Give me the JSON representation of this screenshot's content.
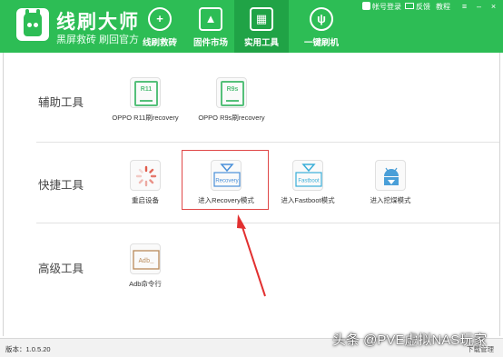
{
  "app": {
    "title": "线刷大师",
    "subtitle": "黑屏救砖 刷回官方"
  },
  "nav": [
    {
      "label": "线刷救砖",
      "icon": "plus-circle-icon"
    },
    {
      "label": "固件市场",
      "icon": "android-icon"
    },
    {
      "label": "实用工具",
      "icon": "grid-icon"
    },
    {
      "label": "一键刷机",
      "icon": "rabbit-icon"
    }
  ],
  "topbar": {
    "user": "帐号登录",
    "feedback": "反馈",
    "tutorial": "教程",
    "menu": "≡",
    "minimize": "–",
    "close": "×"
  },
  "sections": {
    "aux": "辅助工具",
    "quick": "快捷工具",
    "advanced": "高级工具"
  },
  "tools": {
    "r11_label": "OPPO R11刷recovery",
    "r11_icon_text": "R11",
    "r9s_label": "OPPO R9s刷recovery",
    "r9s_icon_text": "R9s",
    "reboot_label": "重启设备",
    "recovery_label": "进入Recovery模式",
    "recovery_icon_text": "Recovery",
    "fastboot_label": "进入Fastboot模式",
    "fastboot_icon_text": "Fastboot",
    "dig_label": "进入挖煤模式",
    "adb_label": "Adb命令行",
    "adb_icon_text": "Adb_"
  },
  "status": {
    "version": "版本：1.0.5.20",
    "download": "下载管理"
  },
  "watermark": "头条 @PVE虚拟NAS玩家",
  "colors": {
    "brand_green": "#2dbd55",
    "active_tab": "#20a346",
    "highlight_red": "#e04848"
  }
}
